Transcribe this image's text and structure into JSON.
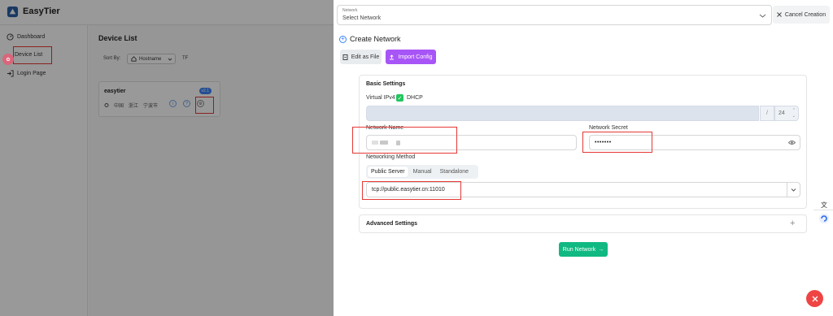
{
  "app": {
    "title": "EasyTier",
    "sidebar": {
      "items": [
        {
          "label": "Dashboard",
          "icon": "dashboard-icon"
        },
        {
          "label": "Device List",
          "icon": "list-icon"
        },
        {
          "label": "Login Page",
          "icon": "login-icon"
        }
      ]
    },
    "device_list": {
      "title": "Device List",
      "sort_by_label": "Sort By:",
      "sort_value": "Hostname",
      "extra_label": "TF",
      "device": {
        "name": "easytier",
        "badge": "v2.1",
        "location": [
          "中国",
          "浙江",
          "宁波市"
        ]
      }
    }
  },
  "drawer": {
    "network_select": {
      "label": "Network",
      "value": "Select Network"
    },
    "cancel_label": "Cancel Creation",
    "create_header": "Create Network",
    "edit_as_file_label": "Edit as File",
    "import_config_label": "Import Config",
    "basic": {
      "title": "Basic Settings",
      "virtual_ipv4_label": "Virtual IPv4",
      "dhcp_label": "DHCP",
      "ip_slash": "/",
      "mask_value": "24",
      "network_name_label": "Network Name",
      "network_secret_label": "Network Secret",
      "network_secret_value": "•••••••",
      "networking_method_label": "Networking Method",
      "methods": [
        "Public Server",
        "Manual",
        "Standalone"
      ],
      "active_method": "Public Server",
      "server_value": "tcp://public.easytier.cn:11010"
    },
    "advanced_title": "Advanced Settings",
    "run_label": "Run Network"
  },
  "colors": {
    "accent": "#3b82f6",
    "import_button": "#a855f7",
    "run_button": "#10b981",
    "dhcp_check": "#22c55e",
    "highlight": "#e53935",
    "fab": "#ef4444"
  }
}
